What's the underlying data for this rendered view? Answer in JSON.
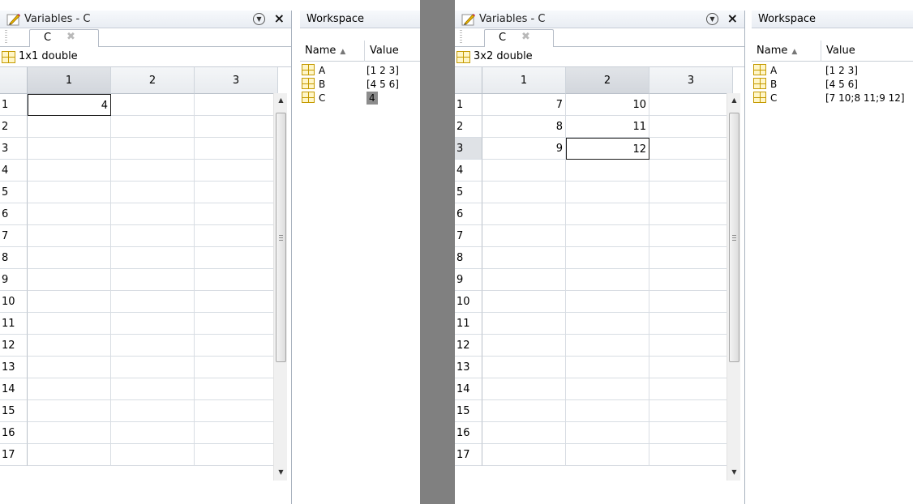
{
  "left": {
    "editor": {
      "title": "Variables - C",
      "tab_label": "C",
      "info": "1x1 double",
      "columns": [
        "1",
        "2",
        "3"
      ],
      "rows": [
        "1",
        "2",
        "3",
        "4",
        "5",
        "6",
        "7",
        "8",
        "9",
        "10",
        "11",
        "12",
        "13",
        "14",
        "15",
        "16",
        "17"
      ],
      "cells": [
        [
          "4",
          "",
          ""
        ]
      ]
    },
    "workspace": {
      "title": "Workspace",
      "name_header": "Name",
      "value_header": "Value",
      "vars": [
        {
          "name": "A",
          "value": "[1 2 3]"
        },
        {
          "name": "B",
          "value": "[4 5 6]"
        },
        {
          "name": "C",
          "value": "4"
        }
      ]
    }
  },
  "right": {
    "editor": {
      "title": "Variables - C",
      "tab_label": "C",
      "info": "3x2 double",
      "columns": [
        "1",
        "2",
        "3"
      ],
      "rows": [
        "1",
        "2",
        "3",
        "4",
        "5",
        "6",
        "7",
        "8",
        "9",
        "10",
        "11",
        "12",
        "13",
        "14",
        "15",
        "16",
        "17"
      ],
      "cells": [
        [
          "7",
          "10",
          ""
        ],
        [
          "8",
          "11",
          ""
        ],
        [
          "9",
          "12",
          ""
        ]
      ]
    },
    "workspace": {
      "title": "Workspace",
      "name_header": "Name",
      "value_header": "Value",
      "vars": [
        {
          "name": "A",
          "value": "[1 2 3]"
        },
        {
          "name": "B",
          "value": "[4 5 6]"
        },
        {
          "name": "C",
          "value": "[7 10;8 11;9 12]"
        }
      ]
    }
  },
  "icons": {
    "pencil": "pencil-icon",
    "dropdown": "dropdown-circle-icon",
    "close": "close-icon",
    "grid": "variable-grid-icon",
    "sort": "sort-ascending-icon"
  }
}
